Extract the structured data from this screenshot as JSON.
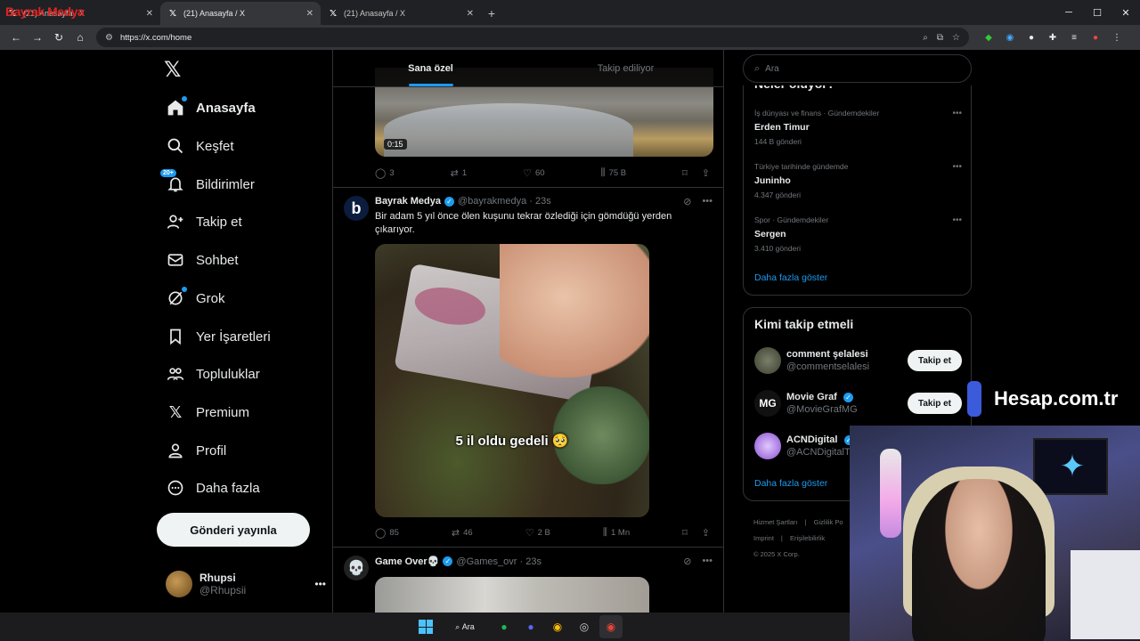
{
  "browser": {
    "tabs": [
      {
        "title": "(21) Anasayfa / X",
        "active": false
      },
      {
        "title": "(21) Anasayfa / X",
        "active": true
      },
      {
        "title": "(21) Anasayfa / X",
        "active": false
      }
    ],
    "overlay_logo": "Bayrak Medya",
    "url": "https://x.com/home"
  },
  "sidebar": {
    "items": [
      {
        "label": "Anasayfa",
        "icon": "home-icon"
      },
      {
        "label": "Keşfet",
        "icon": "search-icon"
      },
      {
        "label": "Bildirimler",
        "icon": "bell-icon",
        "badge": "20+"
      },
      {
        "label": "Takip et",
        "icon": "add-user-icon"
      },
      {
        "label": "Sohbet",
        "icon": "mail-icon"
      },
      {
        "label": "Grok",
        "icon": "grok-icon"
      },
      {
        "label": "Yer İşaretleri",
        "icon": "bookmark-icon"
      },
      {
        "label": "Topluluklar",
        "icon": "communities-icon"
      },
      {
        "label": "Premium",
        "icon": "x-icon"
      },
      {
        "label": "Profil",
        "icon": "profile-icon"
      },
      {
        "label": "Daha fazla",
        "icon": "more-circle-icon"
      }
    ],
    "post_button": "Gönderi yayınla",
    "account": {
      "name": "Rhupsi",
      "handle": "@Rhupsii"
    }
  },
  "feed": {
    "tabs": [
      "Sana özel",
      "Takip ediliyor"
    ],
    "tweet1": {
      "video_time": "0:15",
      "replies": "3",
      "reposts": "1",
      "likes": "60",
      "views": "75 B"
    },
    "tweet2": {
      "name": "Bayrak Medya",
      "handle": "@bayrakmedya",
      "time": "23s",
      "text": "Bir adam 5 yıl önce ölen kuşunu tekrar özlediği için gömdüğü yerden çıkarıyor.",
      "caption": "5 il oldu gedeli 🥺",
      "replies": "85",
      "reposts": "46",
      "likes": "2 B",
      "views": "1 Mn"
    },
    "tweet3": {
      "name": "Game Over💀",
      "handle": "@Games_ovr",
      "time": "23s"
    }
  },
  "right": {
    "search_placeholder": "Ara",
    "trends_title": "Neler oluyor?",
    "trends": [
      {
        "context": "İş dünyası ve finans · Gündemdekiler",
        "title": "Erden Timur",
        "count": "144 B gönderi"
      },
      {
        "context": "Türkiye tarihinde gündemde",
        "title": "Juninho",
        "count": "4.347 gönderi"
      },
      {
        "context": "Spor · Gündemdekiler",
        "title": "Sergen",
        "count": "3.410 gönderi"
      }
    ],
    "show_more": "Daha fazla göster",
    "who_title": "Kimi takip etmeli",
    "who": [
      {
        "name": "comment şelalesi",
        "handle": "@commentselalesi",
        "button": "Takip et"
      },
      {
        "name": "Movie Graf",
        "handle": "@MovieGrafMG",
        "button": "Takip et"
      },
      {
        "name": "ACNDigital",
        "handle": "@ACNDigitalT"
      }
    ],
    "who_show_more": "Daha fazla göster",
    "footer": [
      "Hizmet Şartları",
      "Gizlilik Po",
      "Imprint",
      "Erişilebilirlik",
      "© 2025 X Corp."
    ]
  },
  "overlay": {
    "brand": "Hesap.com.tr"
  },
  "taskbar": {
    "search": "Ara"
  }
}
